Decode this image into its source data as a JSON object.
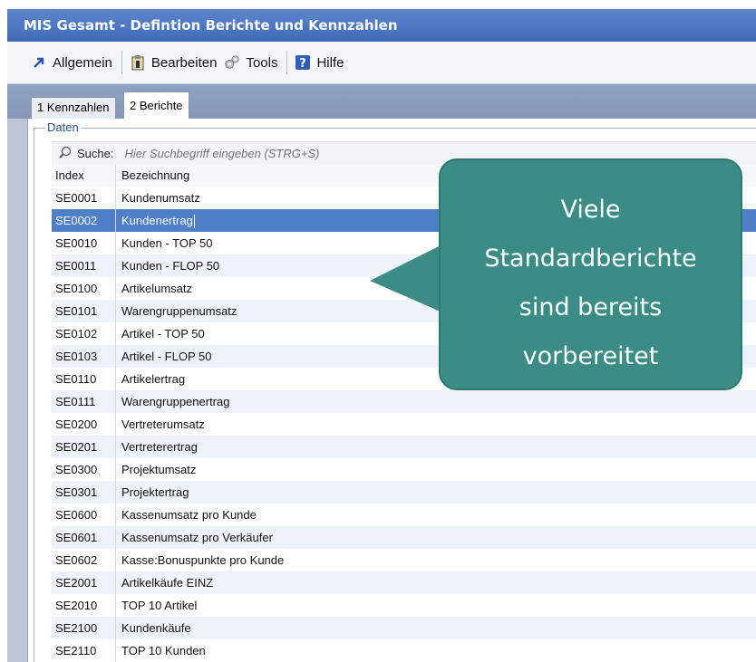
{
  "window": {
    "title": "MIS Gesamt - Defintion Berichte und Kennzahlen"
  },
  "toolbar": {
    "items": [
      {
        "label": "Allgemein",
        "icon": "arrow-icon"
      },
      {
        "label": "Bearbeiten",
        "icon": "clipboard-icon"
      },
      {
        "label": "Tools",
        "icon": "gears-icon"
      },
      {
        "label": "Hilfe",
        "icon": "help-icon"
      }
    ]
  },
  "tabs": [
    {
      "label": "1 Kennzahlen"
    },
    {
      "label": "2 Berichte"
    }
  ],
  "group": {
    "label": "Daten"
  },
  "search": {
    "label": "Suche:",
    "placeholder": "Hier Suchbegriff eingeben (STRG+S)"
  },
  "table": {
    "columns": [
      "Index",
      "Bezeichnung"
    ],
    "rows": [
      [
        "SE0001",
        "Kundenumsatz"
      ],
      [
        "SE0002",
        "Kundenertrag"
      ],
      [
        "SE0010",
        "Kunden - TOP 50"
      ],
      [
        "SE0011",
        "Kunden - FLOP 50"
      ],
      [
        "SE0100",
        "Artikelumsatz"
      ],
      [
        "SE0101",
        "Warengruppenumsatz"
      ],
      [
        "SE0102",
        "Artikel - TOP 50"
      ],
      [
        "SE0103",
        "Artikel - FLOP 50"
      ],
      [
        "SE0110",
        "Artikelertrag"
      ],
      [
        "SE0111",
        "Warengruppenertrag"
      ],
      [
        "SE0200",
        "Vertreterumsatz"
      ],
      [
        "SE0201",
        "Vertreterertrag"
      ],
      [
        "SE0300",
        "Projektumsatz"
      ],
      [
        "SE0301",
        "Projektertrag"
      ],
      [
        "SE0600",
        "Kassenumsatz pro Kunde"
      ],
      [
        "SE0601",
        "Kassenumsatz pro Verkäufer"
      ],
      [
        "SE0602",
        "Kasse:Bonuspunkte pro Kunde"
      ],
      [
        "SE2001",
        "Artikelkäufe EINZ"
      ],
      [
        "SE2010",
        "TOP 10 Artikel"
      ],
      [
        "SE2100",
        "Kundenkäufe"
      ],
      [
        "SE2110",
        "TOP 10 Kunden"
      ]
    ],
    "selected_index": "SE0002"
  },
  "callout": {
    "lines": [
      "Viele",
      "Standardberichte",
      "sind bereits",
      "vorbereitet"
    ]
  },
  "colors": {
    "titlebar": "#4a76c2",
    "selection": "#4f7fc7",
    "callout": "#3b8c84"
  }
}
